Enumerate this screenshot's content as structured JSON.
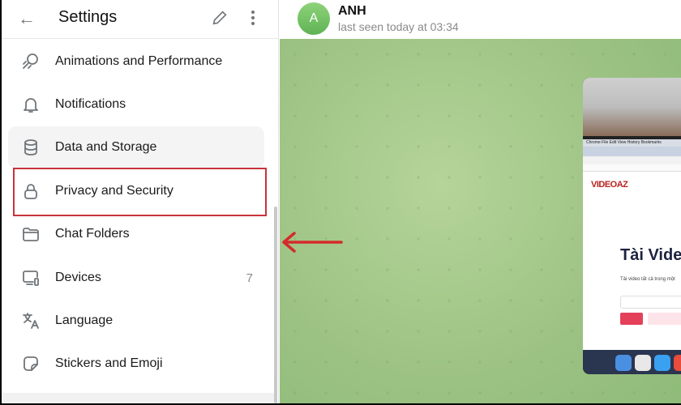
{
  "sidebar": {
    "title": "Settings",
    "items": [
      {
        "label": "Animations and Performance",
        "icon": "animations-icon"
      },
      {
        "label": "Notifications",
        "icon": "bell-icon"
      },
      {
        "label": "Data and Storage",
        "icon": "database-icon"
      },
      {
        "label": "Privacy and Security",
        "icon": "lock-icon"
      },
      {
        "label": "Chat Folders",
        "icon": "folder-icon"
      },
      {
        "label": "Devices",
        "icon": "devices-icon",
        "count": "7"
      },
      {
        "label": "Language",
        "icon": "translate-icon"
      },
      {
        "label": "Stickers and Emoji",
        "icon": "sticker-icon"
      }
    ]
  },
  "chat": {
    "avatar_letter": "A",
    "name": "ANH",
    "status": "last seen today at 03:34",
    "screenshot": {
      "menubar": "Chrome  File  Edit  View  History  Bookmarks",
      "logo": "VIDEOAZ",
      "heading": "Tài Video",
      "subtext": "Tải video tất cả trong một"
    }
  },
  "annotation": {
    "color": "#c8333a"
  }
}
